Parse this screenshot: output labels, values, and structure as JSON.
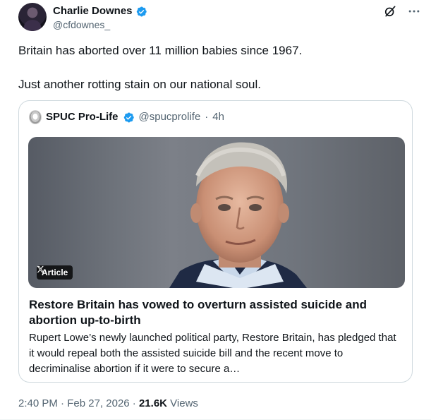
{
  "author": {
    "name": "Charlie Downes",
    "handle": "@cfdownes_",
    "verified": true
  },
  "tweet": {
    "paragraph_1": "Britain has aborted over 11 million babies since 1967.",
    "paragraph_2": "Just another rotting stain on our national soul."
  },
  "quoted": {
    "name": "SPUC Pro-Life",
    "handle": "@spucprolife",
    "separator": "·",
    "time": "4h",
    "verified": true,
    "badge_label": "Article",
    "article_title": "Restore Britain has vowed to overturn assisted suicide and abortion up-to-birth",
    "article_summary": "Rupert Lowe’s newly launched political party, Restore Britain, has pledged that it would repeal both the assisted suicide bill and the recent move to decriminalise abortion if it were to secure a…"
  },
  "meta": {
    "time": "2:40 PM",
    "sep1": "·",
    "date": "Feb 27, 2026",
    "sep2": "·",
    "views_count": "21.6K",
    "views_label": "Views"
  },
  "colors": {
    "verified_blue": "#1d9bf0",
    "secondary_text": "#536471",
    "primary_text": "#0f1419",
    "border": "#cfd9de"
  },
  "icons": [
    "verified-badge-icon",
    "grok-icon",
    "more-icon",
    "x-logo-icon"
  ]
}
